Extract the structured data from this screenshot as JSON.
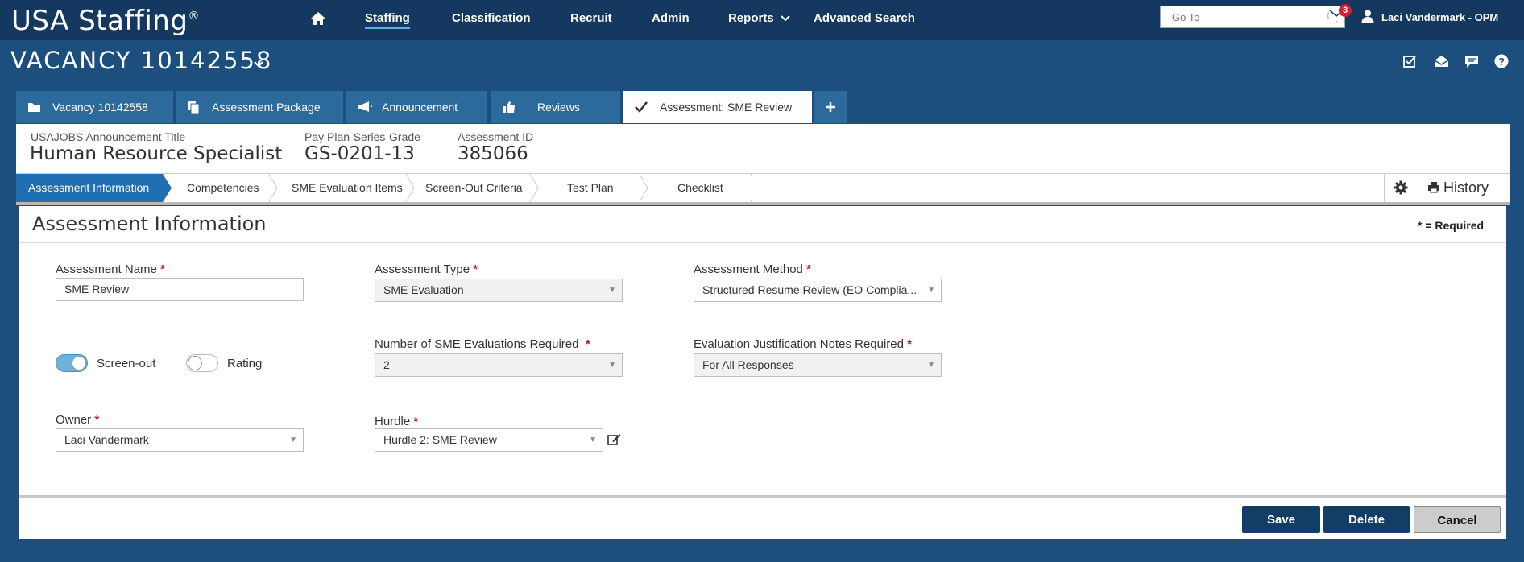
{
  "app": {
    "logo": "USA Staffing",
    "logo_mark": "®",
    "nav": [
      "Staffing",
      "Classification",
      "Recruit",
      "Admin",
      "Reports",
      "Advanced Search"
    ],
    "search_placeholder": "Go To",
    "mail_count": "3",
    "user": "Laci Vandermark - OPM"
  },
  "vacancy": {
    "title": "VACANCY 10142558"
  },
  "tabs": [
    "Vacancy 10142558",
    "Assessment Package",
    "Announcement",
    "Reviews",
    "Assessment: SME Review"
  ],
  "info": {
    "announcement_label": "USAJOBS Announcement Title",
    "announcement_value": "Human Resource Specialist",
    "grade_label": "Pay Plan-Series-Grade",
    "grade_value": "GS-0201-13",
    "id_label": "Assessment ID",
    "id_value": "385066"
  },
  "steps": [
    "Assessment Information",
    "Competencies",
    "SME Evaluation Items",
    "Screen-Out Criteria",
    "Test Plan",
    "Checklist"
  ],
  "history_label": "History",
  "form": {
    "title": "Assessment Information",
    "required_note": "* = Required",
    "name_label": "Assessment Name",
    "name_value": "SME Review",
    "type_label": "Assessment Type",
    "type_value": "SME Evaluation",
    "method_label": "Assessment Method",
    "method_value": "Structured Resume Review (EO Complia...",
    "screenout_label": "Screen-out",
    "screenout_on": true,
    "rating_label": "Rating",
    "rating_on": false,
    "sme_count_label": "Number of SME Evaluations Required",
    "sme_count_value": "2",
    "justification_label": "Evaluation Justification Notes Required",
    "justification_value": "For All Responses",
    "owner_label": "Owner",
    "owner_value": "Laci Vandermark",
    "hurdle_label": "Hurdle",
    "hurdle_value": "Hurdle 2: SME Review",
    "star": "*"
  },
  "buttons": {
    "save": "Save",
    "delete": "Delete",
    "cancel": "Cancel"
  },
  "colors": {
    "nav": "#14385f",
    "body": "#1c4f7e",
    "accent": "#1f6fb2",
    "badge": "#d0202f"
  }
}
